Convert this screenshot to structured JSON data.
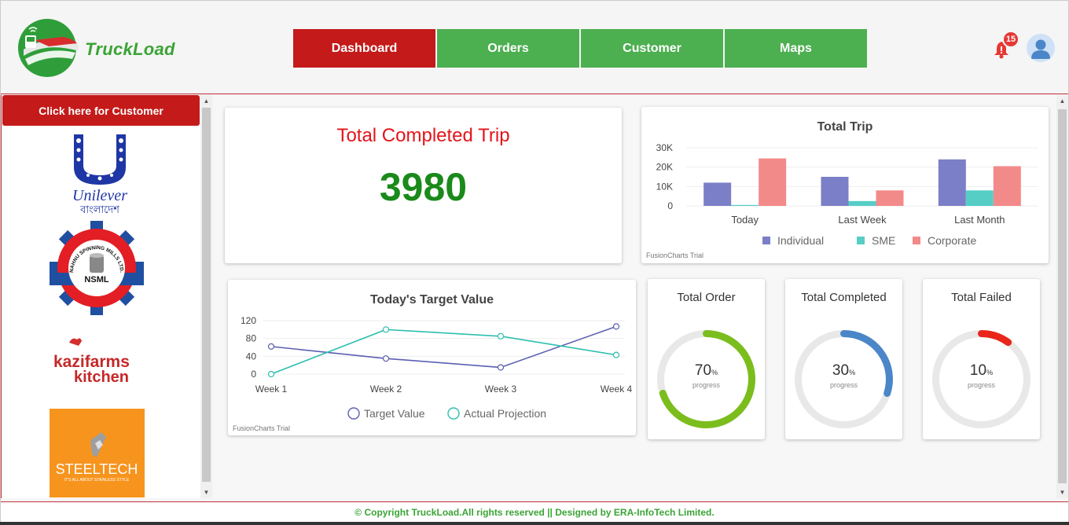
{
  "app": {
    "brand": "TruckLoad"
  },
  "nav": {
    "tabs": [
      {
        "label": "Dashboard",
        "active": true
      },
      {
        "label": "Orders",
        "active": false
      },
      {
        "label": "Customer",
        "active": false
      },
      {
        "label": "Maps",
        "active": false
      }
    ]
  },
  "header": {
    "notification_count": "15",
    "icons": [
      "bell-icon",
      "user-avatar-icon"
    ]
  },
  "sidebar": {
    "customer_button": "Click here for Customer",
    "clients": [
      {
        "name": "Unilever বাংলাদেশ",
        "wordmark": "Unilever",
        "subtitle": "বাংলাদেশ"
      },
      {
        "name": "NSML",
        "wordmark": "NSML",
        "ring_text": "NAHNU SPINNING MILLS LTD."
      },
      {
        "name": "kazifarms kitchen",
        "wordmark": "kazifarms",
        "subtitle": "kitchen"
      },
      {
        "name": "STEELTECH",
        "wordmark": "STEELTECH",
        "tagline": "IT'S ALL ABOUT STAINLESS STYLE"
      }
    ]
  },
  "summary": {
    "title": "Total Completed Trip",
    "value": "3980"
  },
  "total_trip": {
    "title": "Total Trip",
    "trial": "FusionCharts Trial",
    "chart_data": {
      "type": "bar",
      "title": "Total Trip",
      "categories": [
        "Today",
        "Last Week",
        "Last Month"
      ],
      "series": [
        {
          "name": "Individual",
          "color": "#7b7fc7",
          "values": [
            12000,
            15000,
            24000
          ]
        },
        {
          "name": "SME",
          "color": "#56cec6",
          "values": [
            500,
            2500,
            8000
          ]
        },
        {
          "name": "Corporate",
          "color": "#f38a8a",
          "values": [
            24500,
            8000,
            20500
          ]
        }
      ],
      "ylim": [
        0,
        30000
      ],
      "yticks": [
        "0",
        "10K",
        "20K",
        "30K"
      ],
      "legend": "bottom"
    }
  },
  "target": {
    "title": "Today's Target Value",
    "trial": "FusionCharts Trial",
    "chart_data": {
      "type": "line",
      "title": "Today's Target Value",
      "categories": [
        "Week 1",
        "Week 2",
        "Week 3",
        "Week 4"
      ],
      "series": [
        {
          "name": "Target Value",
          "color": "#5c5fb1",
          "values": [
            62,
            35,
            15,
            107
          ]
        },
        {
          "name": "Actual Projection",
          "color": "#2ebfb0",
          "values": [
            0,
            100,
            85,
            43
          ]
        }
      ],
      "ylim": [
        0,
        120
      ],
      "yticks": [
        "0",
        "40",
        "80",
        "120"
      ],
      "legend": "bottom"
    }
  },
  "progress": [
    {
      "title": "Total Order",
      "value": "70",
      "percent": 70,
      "unit": "%",
      "label": "progress",
      "color": "#7cbd1e"
    },
    {
      "title": "Total Completed",
      "value": "30",
      "percent": 30,
      "unit": "%",
      "label": "progress",
      "color": "#4a86c8"
    },
    {
      "title": "Total Failed",
      "value": "10",
      "percent": 10,
      "unit": "%",
      "label": "progress",
      "color": "#e8261a"
    }
  ],
  "footer": {
    "text": "© Copyright TruckLoad.All rights reserved || Designed by ERA-InfoTech Limited."
  }
}
